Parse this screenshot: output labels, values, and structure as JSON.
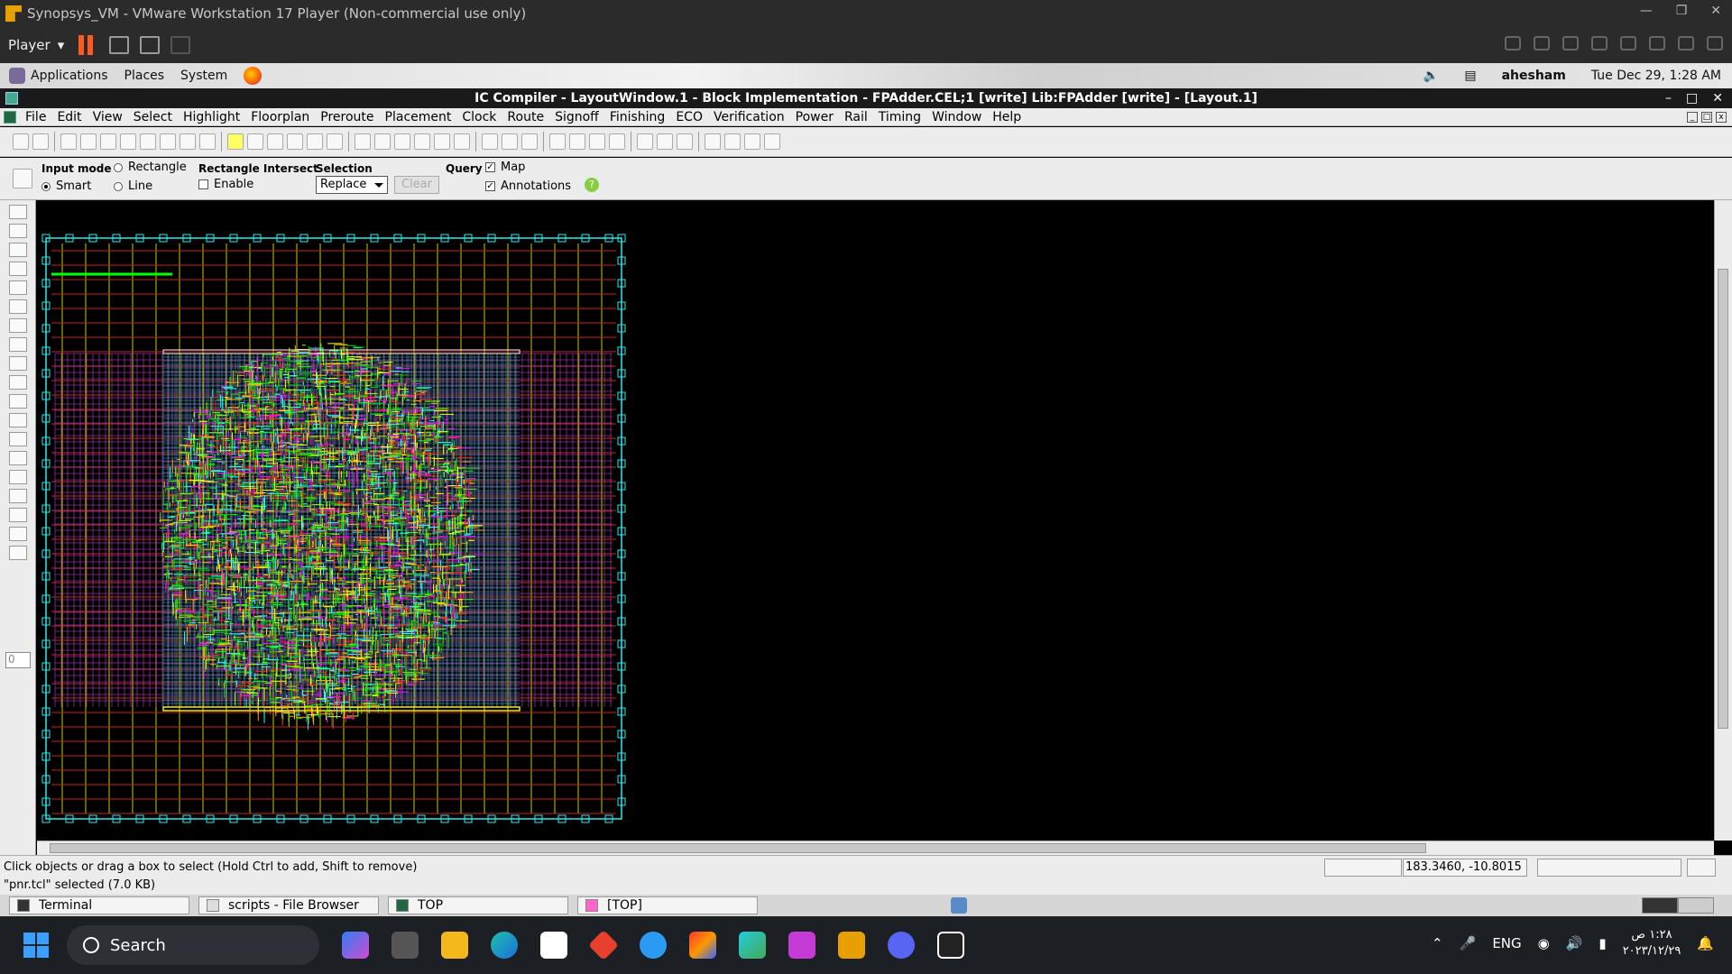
{
  "vm": {
    "title": "Synopsys_VM - VMware Workstation 17 Player (Non-commercial use only)",
    "player_label": "Player"
  },
  "gnome": {
    "menus": [
      "Applications",
      "Places",
      "System"
    ],
    "user": "ahesham",
    "datetime": "Tue Dec 29,  1:28 AM"
  },
  "app": {
    "title": "IC Compiler - LayoutWindow.1 - Block Implementation - FPAdder.CEL;1 [write]     Lib:FPAdder [write] - [Layout.1]"
  },
  "menubar": [
    "File",
    "Edit",
    "View",
    "Select",
    "Highlight",
    "Floorplan",
    "Preroute",
    "Placement",
    "Clock",
    "Route",
    "Signoff",
    "Finishing",
    "ECO",
    "Verification",
    "Power",
    "Rail",
    "Timing",
    "Window",
    "Help"
  ],
  "options": {
    "input_mode_label": "Input mode",
    "smart": "Smart",
    "rectangle": "Rectangle",
    "line": "Line",
    "rect_intersect_label": "Rectangle Intersect",
    "enable": "Enable",
    "selection_label": "Selection",
    "selection_value": "Replace",
    "clear": "Clear",
    "query_label": "Query",
    "map": "Map",
    "annotations": "Annotations",
    "help": "?"
  },
  "left_coord": "0",
  "status": {
    "message": "Click objects or drag a box to select (Hold Ctrl to add, Shift to remove)",
    "coords": "183.3460, -10.8015"
  },
  "selinfo": "\"pnr.tcl\" selected (7.0 KB)",
  "tasks": [
    {
      "label": "Terminal"
    },
    {
      "label": "scripts - File Browser"
    },
    {
      "label": "TOP"
    },
    {
      "label": "[TOP]"
    }
  ],
  "taskbar": {
    "search": "Search",
    "lang": "ENG",
    "time": "١:٢٨ ص",
    "date": "٢٠٢٣/١٢/٢٩"
  },
  "colors": {
    "canvas": "#000000",
    "accent": "#3aa0ff"
  }
}
